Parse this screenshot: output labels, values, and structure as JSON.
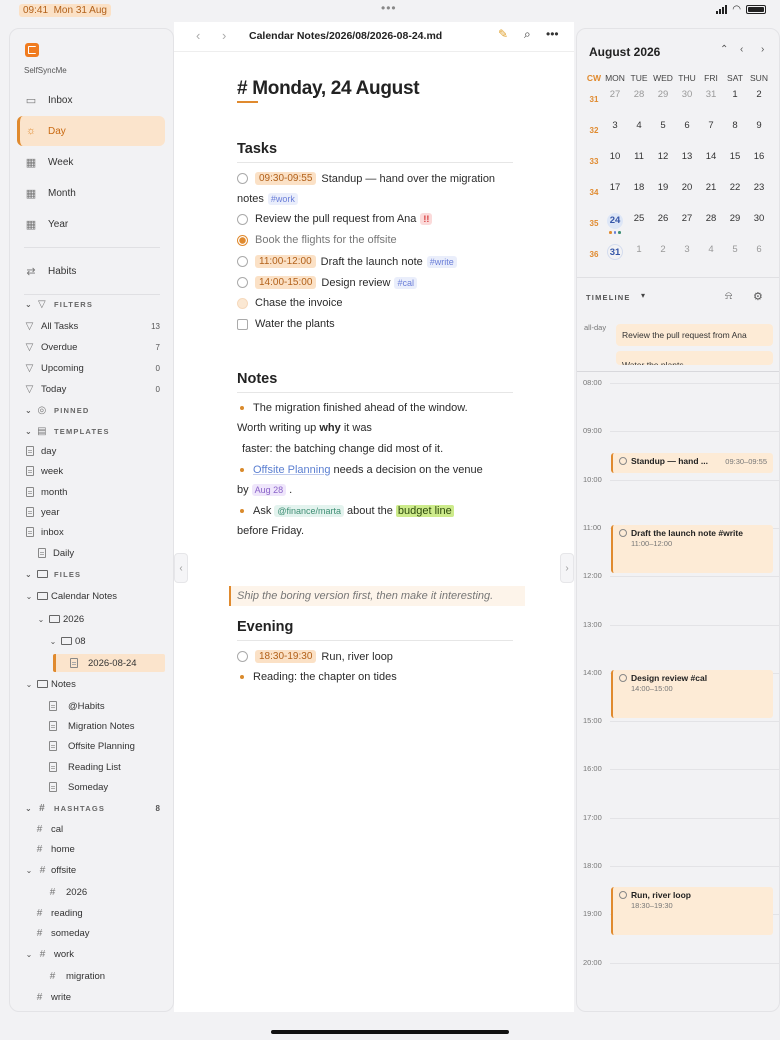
{
  "status": {
    "time": "09:41",
    "date": "Mon 31 Aug"
  },
  "sidebar": {
    "app_name": "SelfSyncMe",
    "nav": [
      {
        "label": "Inbox",
        "icon": "inbox-icon"
      },
      {
        "label": "Day",
        "icon": "sun-icon",
        "active": true
      },
      {
        "label": "Week",
        "icon": "calendar-icon"
      },
      {
        "label": "Month",
        "icon": "calendar-icon"
      },
      {
        "label": "Year",
        "icon": "calendar-icon"
      }
    ],
    "habits": "Habits",
    "filters_header": "FILTERS",
    "filters": [
      {
        "label": "All Tasks",
        "count": "13"
      },
      {
        "label": "Overdue",
        "count": "7"
      },
      {
        "label": "Upcoming",
        "count": "0"
      },
      {
        "label": "Today",
        "count": "0"
      }
    ],
    "pinned_header": "PINNED",
    "templates_header": "TEMPLATES",
    "templates": [
      "day",
      "week",
      "month",
      "year",
      "inbox"
    ],
    "template_child": "Daily",
    "files_header": "FILES",
    "files": {
      "calendar_notes": "Calendar Notes",
      "year": "2026",
      "month": "08",
      "selected_file": "2026-08-24",
      "notes": "Notes",
      "notes_children": [
        "@Habits",
        "Migration Notes",
        "Offsite Planning",
        "Reading List",
        "Someday"
      ]
    },
    "hashtags_header": "HASHTAGS",
    "hashtags_count": "8",
    "hashtags": {
      "cal": "cal",
      "home": "home",
      "offsite": "offsite",
      "offsite_child": "2026",
      "reading": "reading",
      "someday": "someday",
      "work": "work",
      "work_child": "migration",
      "write": "write"
    }
  },
  "editor": {
    "path": "Calendar Notes/2026/08/2026-08-24.md",
    "title": "Monday, 24 August",
    "tasks_heading": "Tasks",
    "tasks": {
      "t1_time": "09:30-09:55",
      "t1_text": "Standup — hand over the migration",
      "t1_text2": "notes",
      "t1_tag": "#work",
      "t2_text": "Review the pull request from Ana",
      "t2_prio": "!!",
      "t3_text": "Book the flights for the offsite",
      "t4_time": "11:00-12:00",
      "t4_text": "Draft the launch note",
      "t4_tag": "#write",
      "t5_time": "14:00-15:00",
      "t5_text": "Design review",
      "t5_tag": "#cal",
      "t6_text": "Chase the invoice",
      "t7_text": "Water the plants"
    },
    "notes_heading": "Notes",
    "notes": {
      "n1_a": "The migration finished ahead of the window.",
      "n1_b": "Worth writing up",
      "n1_bold": "why",
      "n1_c": "it was",
      "n1_d": "faster: the batching change did most of it.",
      "n2_link": "Offsite Planning",
      "n2_a": "needs a decision on the venue",
      "n2_b": "by",
      "n2_date": "Aug 28",
      "n2_c": ".",
      "n3_a": "Ask",
      "n3_mention": "@finance/marta",
      "n3_b": "about the",
      "n3_hl": "budget line",
      "n3_c": "before Friday."
    },
    "quote": "Ship the boring version first, then make it interesting.",
    "evening_heading": "Evening",
    "evening": {
      "e1_time": "18:30-19:30",
      "e1_text": "Run, river loop",
      "e2_text": "Reading: the chapter on tides"
    }
  },
  "calendar": {
    "title": "August 2026",
    "headers": [
      "CW",
      "MON",
      "TUE",
      "WED",
      "THU",
      "FRI",
      "SAT",
      "SUN"
    ],
    "weeks": [
      {
        "cw": "31",
        "days": [
          "27",
          "28",
          "29",
          "30",
          "31",
          "1",
          "2"
        ]
      },
      {
        "cw": "32",
        "days": [
          "3",
          "4",
          "5",
          "6",
          "7",
          "8",
          "9"
        ]
      },
      {
        "cw": "33",
        "days": [
          "10",
          "11",
          "12",
          "13",
          "14",
          "15",
          "16"
        ]
      },
      {
        "cw": "34",
        "days": [
          "17",
          "18",
          "19",
          "20",
          "21",
          "22",
          "23"
        ]
      },
      {
        "cw": "35",
        "days": [
          "24",
          "25",
          "26",
          "27",
          "28",
          "29",
          "30"
        ]
      },
      {
        "cw": "36",
        "days": [
          "31",
          "1",
          "2",
          "3",
          "4",
          "5",
          "6"
        ]
      }
    ]
  },
  "timeline": {
    "label": "TIMELINE",
    "allday_label": "all-day",
    "allday": [
      "Review the pull request from Ana",
      "Water the plants"
    ],
    "hours": [
      "08:00",
      "09:00",
      "10:00",
      "11:00",
      "12:00",
      "13:00",
      "14:00",
      "15:00",
      "16:00",
      "17:00",
      "18:00",
      "19:00",
      "20:00"
    ],
    "events": {
      "ev1_title": "Standup — hand ...",
      "ev1_time": "09:30–09:55",
      "ev2_title": "Draft the launch note #write",
      "ev2_time": "11:00–12:00",
      "ev3_title": "Design review #cal",
      "ev3_time": "14:00–15:00",
      "ev4_title": "Run, river loop",
      "ev4_time": "18:30–19:30"
    }
  },
  "colors": {
    "accent": "#e08a2e",
    "accent_bg": "#fbe4cc",
    "link": "#5b7fd1"
  }
}
